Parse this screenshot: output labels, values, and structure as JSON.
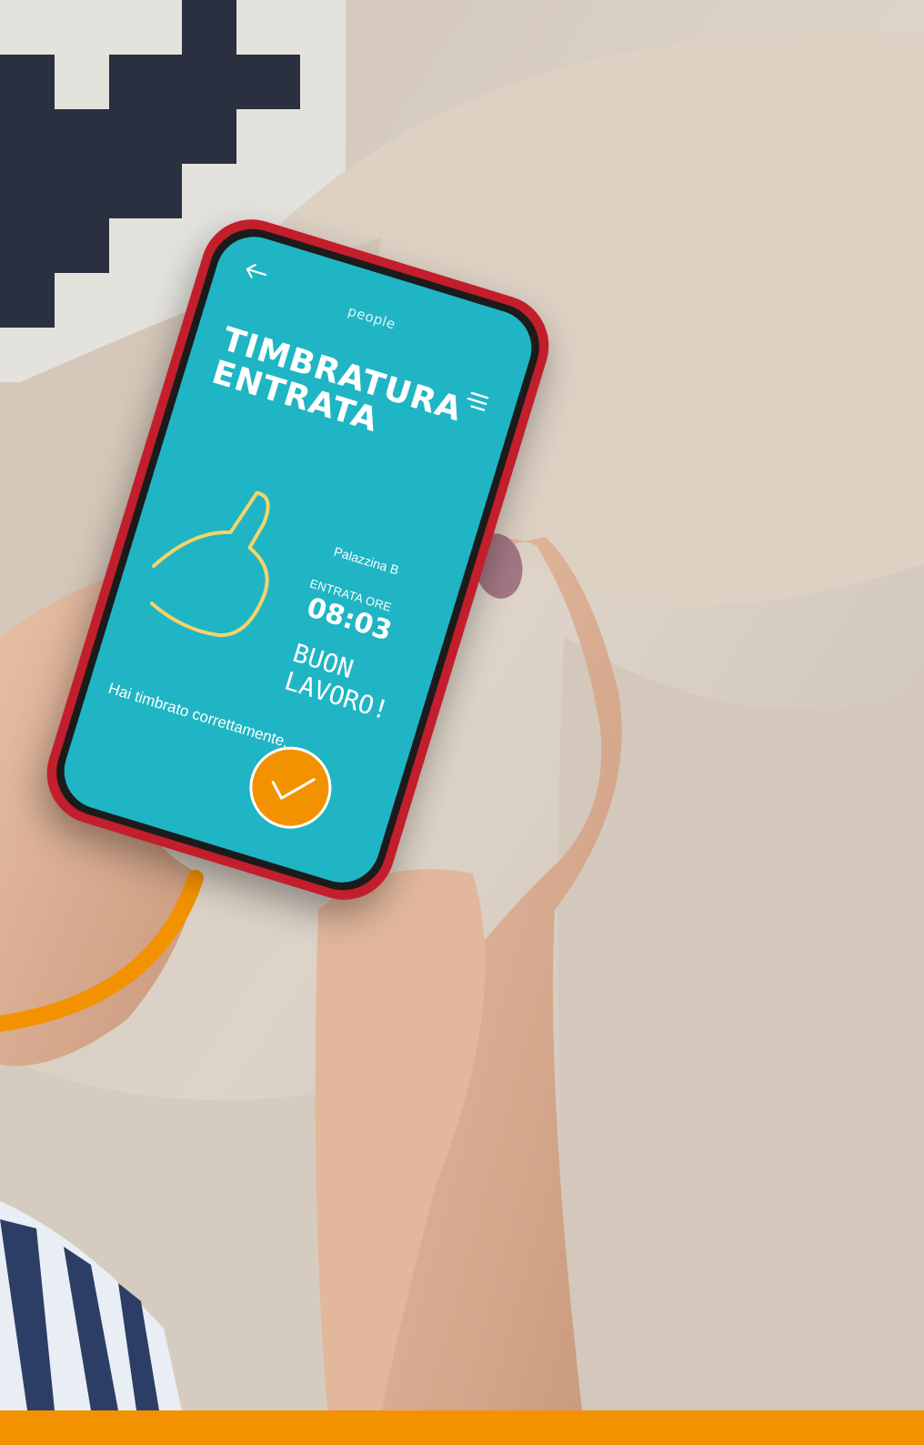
{
  "colors": {
    "screen": "#1fb5c4",
    "phone_case": "#c21e2c",
    "accent_orange": "#f39200",
    "thumb_outline": "#f5d36a",
    "fabric": "#d8cfc4"
  },
  "app": {
    "logo": "people",
    "back_icon": "arrow-left-icon",
    "menu_icon": "menu-icon",
    "title_line1": "TIMBRATURA",
    "title_line2": "ENTRATA",
    "location": "Palazzina B",
    "entry_label": "ENTRATA ORE",
    "entry_time": "08:03",
    "greeting_line1": "BUON",
    "greeting_line2": "LAVORO!",
    "confirm_text": "Hai timbrato correttamente.",
    "check_icon": "check-icon"
  }
}
